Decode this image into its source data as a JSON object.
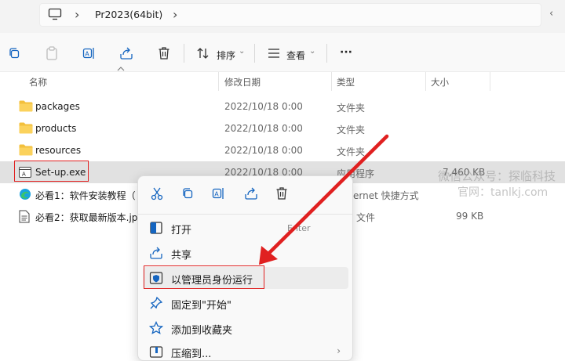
{
  "address_bar": {
    "path_label": "Pr2023(64bit)",
    "chevron": "›",
    "right_glyph": "‹"
  },
  "toolbar": {
    "sort_label": "排序",
    "view_label": "查看",
    "more_label": "···"
  },
  "columns": {
    "name": "名称",
    "modified": "修改日期",
    "type": "类型",
    "size": "大小"
  },
  "files": [
    {
      "name": "packages",
      "date": "2022/10/18 0:00",
      "type": "文件夹",
      "size": "",
      "icon": "folder-icon"
    },
    {
      "name": "products",
      "date": "2022/10/18 0:00",
      "type": "文件夹",
      "size": "",
      "icon": "folder-icon"
    },
    {
      "name": "resources",
      "date": "2022/10/18 0:00",
      "type": "文件夹",
      "size": "",
      "icon": "folder-icon"
    },
    {
      "name": "Set-up.exe",
      "date": "2022/10/18 0:00",
      "type": "应用程序",
      "size": "7,460 KB",
      "icon": "exe-icon"
    },
    {
      "name": "必看1：软件安装教程（",
      "date": "",
      "type": "ernet 快捷方式",
      "size": "",
      "icon": "edge-shortcut-icon"
    },
    {
      "name": "必看2：获取最新版本.jp",
      "date": "",
      "type": "文件",
      "size": "99 KB",
      "icon": "text-file-icon"
    }
  ],
  "context_menu": {
    "enter_hint": "Enter",
    "items": [
      {
        "label": "打开",
        "icon": "open-icon"
      },
      {
        "label": "共享",
        "icon": "share-icon"
      },
      {
        "label": "以管理员身份运行",
        "icon": "shield-icon"
      },
      {
        "label": "固定到\"开始\"",
        "icon": "pin-icon"
      },
      {
        "label": "添加到收藏夹",
        "icon": "star-icon"
      },
      {
        "label": "压缩到...",
        "icon": "zip-icon"
      }
    ],
    "submenu_chevron": "›"
  },
  "watermark": {
    "line1": "微信公众号：探临科技",
    "line2": "官网：tanlkj.com"
  },
  "colors": {
    "highlight_red": "#e02020",
    "folder_yellow": "#f3c03c",
    "accent_blue": "#1565c0"
  }
}
